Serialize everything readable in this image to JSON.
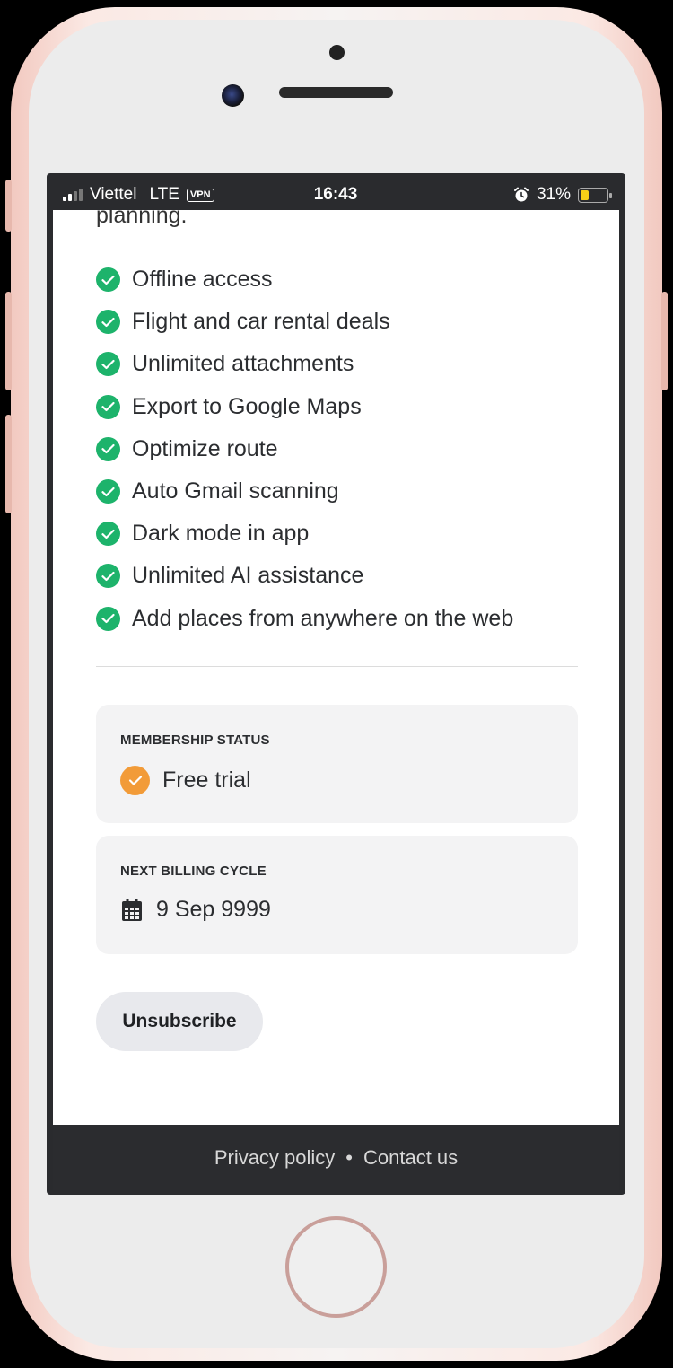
{
  "status_bar": {
    "carrier": "Viettel",
    "network": "LTE",
    "vpn": "VPN",
    "time": "16:43",
    "battery_percent": "31%",
    "battery_level": 0.31,
    "battery_color": "#f7d117"
  },
  "header_partial": "planning.",
  "features": [
    "Offline access",
    "Flight and car rental deals",
    "Unlimited attachments",
    "Export to Google Maps",
    "Optimize route",
    "Auto Gmail scanning",
    "Dark mode in app",
    "Unlimited AI assistance",
    "Add places from anywhere on the web"
  ],
  "membership": {
    "label": "MEMBERSHIP STATUS",
    "value": "Free trial",
    "icon": "check-circle-icon"
  },
  "billing": {
    "label": "NEXT BILLING CYCLE",
    "value": "9 Sep 9999",
    "icon": "calendar-icon"
  },
  "unsubscribe_label": "Unsubscribe",
  "footer": {
    "privacy": "Privacy policy",
    "separator": "•",
    "contact": "Contact us"
  },
  "colors": {
    "check_green": "#1db36b",
    "trial_orange": "#f29b38",
    "footer_bg": "#2b2c2f"
  }
}
